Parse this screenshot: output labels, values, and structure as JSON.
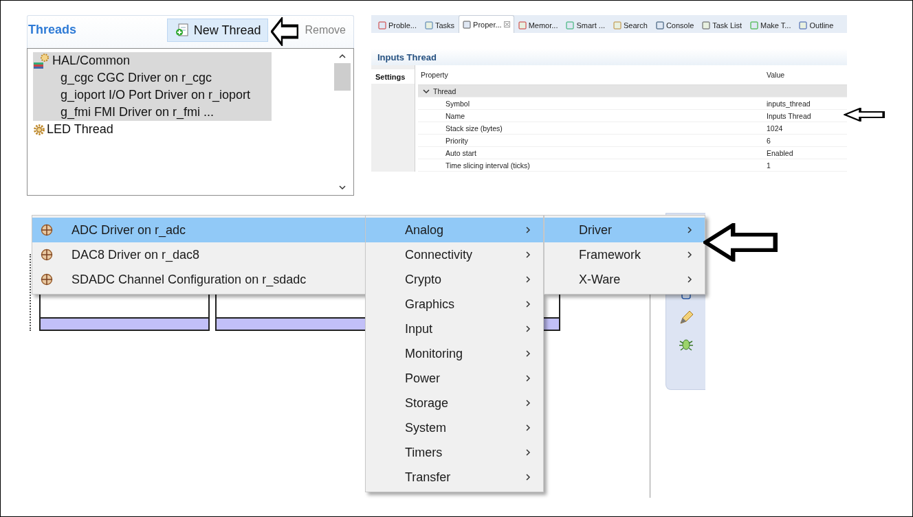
{
  "threads_panel": {
    "title": "Threads",
    "buttons": [
      {
        "kind": "new",
        "label": "New Thread",
        "disabled": false
      },
      {
        "kind": "remove",
        "label": "Remove",
        "disabled": true
      }
    ],
    "tree": [
      {
        "label": "HAL/Common",
        "kind": "hal",
        "selected": true,
        "children": [
          {
            "label": "g_cgc CGC Driver on r_cgc",
            "selected": true
          },
          {
            "label": "g_ioport I/O Port Driver on r_ioport",
            "selected": true
          },
          {
            "label": "g_fmi FMI Driver on r_fmi ...",
            "selected": true
          }
        ]
      },
      {
        "label": "LED Thread",
        "kind": "thread",
        "selected": false
      }
    ]
  },
  "properties_view": {
    "tabs": [
      {
        "label": "Proble...",
        "selected": false
      },
      {
        "label": "Tasks",
        "selected": false
      },
      {
        "label": "Proper...",
        "selected": true
      },
      {
        "label": "Memor...",
        "selected": false
      },
      {
        "label": "Smart ...",
        "selected": false
      },
      {
        "label": "Search",
        "selected": false
      },
      {
        "label": "Console",
        "selected": false
      },
      {
        "label": "Task List",
        "selected": false
      },
      {
        "label": "Make T...",
        "selected": false
      },
      {
        "label": "Outline",
        "selected": false
      }
    ],
    "title": "Inputs Thread",
    "side_tabs": [
      {
        "label": "Settings",
        "selected": true
      }
    ],
    "columns": [
      "Property",
      "Value"
    ],
    "group": {
      "label": "Thread",
      "expanded": true,
      "rows": [
        {
          "property": "Symbol",
          "value": "inputs_thread"
        },
        {
          "property": "Name",
          "value": "Inputs Thread"
        },
        {
          "property": "Stack size (bytes)",
          "value": "1024"
        },
        {
          "property": "Priority",
          "value": "6"
        },
        {
          "property": "Auto start",
          "value": "Enabled"
        },
        {
          "property": "Time slicing interval (ticks)",
          "value": "1"
        }
      ]
    }
  },
  "menus": [
    {
      "items": [
        {
          "label": "ADC Driver on r_adc",
          "kind": "component",
          "selected": true
        },
        {
          "label": "DAC8 Driver on r_dac8",
          "kind": "component",
          "selected": false
        },
        {
          "label": "SDADC Channel Configuration on r_sdadc",
          "kind": "component",
          "selected": false
        }
      ]
    },
    {
      "items": [
        {
          "label": "Analog",
          "kind": "submenu",
          "selected": true
        },
        {
          "label": "Connectivity",
          "kind": "submenu",
          "selected": false
        },
        {
          "label": "Crypto",
          "kind": "submenu",
          "selected": false
        },
        {
          "label": "Graphics",
          "kind": "submenu",
          "selected": false
        },
        {
          "label": "Input",
          "kind": "submenu",
          "selected": false
        },
        {
          "label": "Monitoring",
          "kind": "submenu",
          "selected": false
        },
        {
          "label": "Power",
          "kind": "submenu",
          "selected": false
        },
        {
          "label": "Storage",
          "kind": "submenu",
          "selected": false
        },
        {
          "label": "System",
          "kind": "submenu",
          "selected": false
        },
        {
          "label": "Timers",
          "kind": "submenu",
          "selected": false
        },
        {
          "label": "Transfer",
          "kind": "submenu",
          "selected": false
        }
      ]
    },
    {
      "items": [
        {
          "label": "Driver",
          "kind": "submenu",
          "selected": true
        },
        {
          "label": "Framework",
          "kind": "submenu",
          "selected": false
        },
        {
          "label": "X-Ware",
          "kind": "submenu",
          "selected": false
        }
      ]
    }
  ]
}
